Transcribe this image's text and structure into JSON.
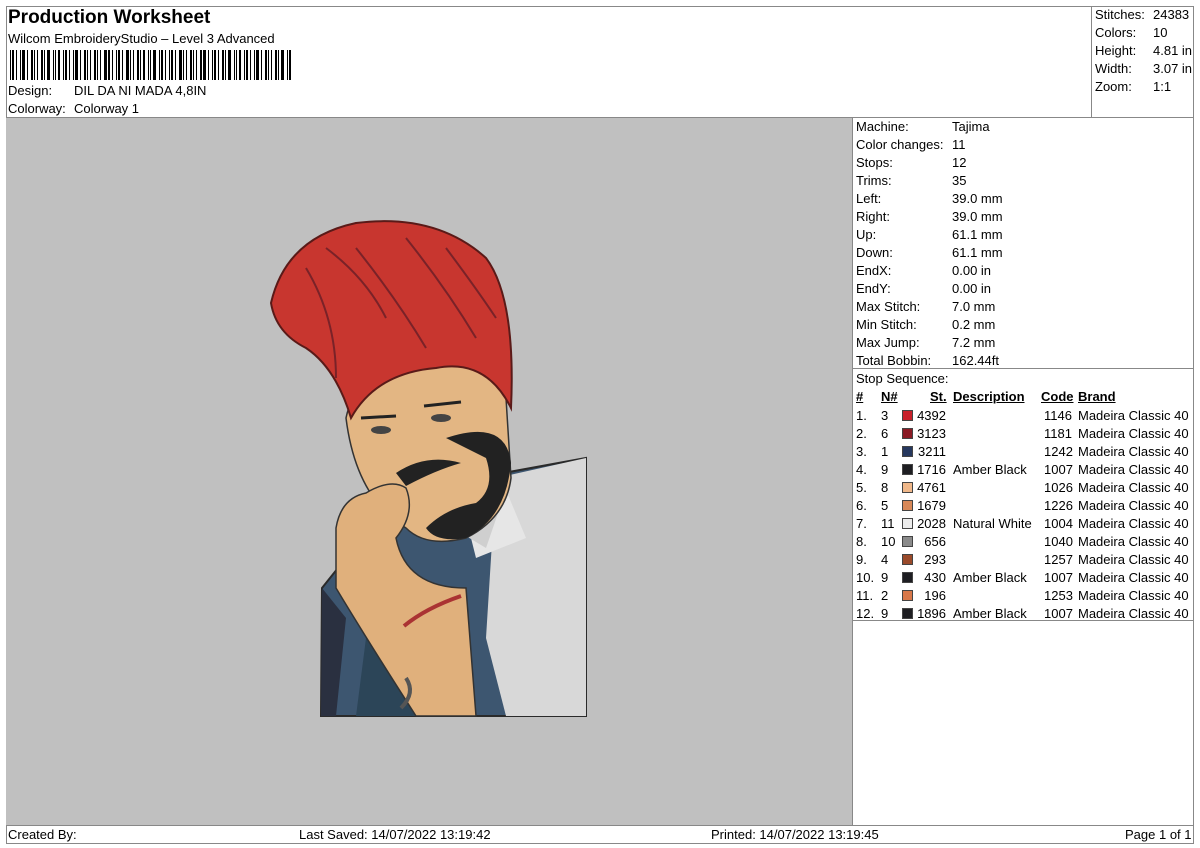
{
  "header": {
    "title": "Production Worksheet",
    "subtitle": "Wilcom EmbroideryStudio – Level 3 Advanced",
    "design_label": "Design:",
    "design_value": "DIL DA NI MADA 4,8IN",
    "colorway_label": "Colorway:",
    "colorway_value": "Colorway 1"
  },
  "summary": [
    {
      "label": "Stitches:",
      "value": "24383"
    },
    {
      "label": "Colors:",
      "value": "10"
    },
    {
      "label": "Height:",
      "value": "4.81 in"
    },
    {
      "label": "Width:",
      "value": "3.07 in"
    },
    {
      "label": "Zoom:",
      "value": "1:1"
    }
  ],
  "machine": [
    {
      "label": "Machine:",
      "value": "Tajima"
    },
    {
      "label": "Color changes:",
      "value": "11"
    },
    {
      "label": "Stops:",
      "value": "12"
    },
    {
      "label": "Trims:",
      "value": "35"
    },
    {
      "label": "Left:",
      "value": "39.0 mm"
    },
    {
      "label": "Right:",
      "value": "39.0 mm"
    },
    {
      "label": "Up:",
      "value": "61.1 mm"
    },
    {
      "label": "Down:",
      "value": "61.1 mm"
    },
    {
      "label": "EndX:",
      "value": "0.00 in"
    },
    {
      "label": "EndY:",
      "value": "0.00 in"
    },
    {
      "label": "Max Stitch:",
      "value": "7.0 mm"
    },
    {
      "label": "Min Stitch:",
      "value": "0.2 mm"
    },
    {
      "label": "Max Jump:",
      "value": "7.2 mm"
    },
    {
      "label": "Total Bobbin:",
      "value": "162.44ft"
    }
  ],
  "stop_sequence": {
    "title": "Stop Sequence:",
    "headers": {
      "num": "#",
      "n": "N#",
      "st": "St.",
      "desc": "Description",
      "code": "Code",
      "brand": "Brand"
    },
    "rows": [
      {
        "num": "1.",
        "n": "3",
        "color": "#c8202a",
        "st": "4392",
        "desc": "",
        "code": "1146",
        "brand": "Madeira Classic 40"
      },
      {
        "num": "2.",
        "n": "6",
        "color": "#8a1a24",
        "st": "3123",
        "desc": "",
        "code": "1181",
        "brand": "Madeira Classic 40"
      },
      {
        "num": "3.",
        "n": "1",
        "color": "#26385e",
        "st": "3211",
        "desc": "",
        "code": "1242",
        "brand": "Madeira Classic 40"
      },
      {
        "num": "4.",
        "n": "9",
        "color": "#1e1e22",
        "st": "1716",
        "desc": "Amber Black",
        "code": "1007",
        "brand": "Madeira Classic 40"
      },
      {
        "num": "5.",
        "n": "8",
        "color": "#f0b88a",
        "st": "4761",
        "desc": "",
        "code": "1026",
        "brand": "Madeira Classic 40"
      },
      {
        "num": "6.",
        "n": "5",
        "color": "#d88858",
        "st": "1679",
        "desc": "",
        "code": "1226",
        "brand": "Madeira Classic 40"
      },
      {
        "num": "7.",
        "n": "11",
        "color": "#ececec",
        "st": "2028",
        "desc": "Natural White",
        "code": "1004",
        "brand": "Madeira Classic 40"
      },
      {
        "num": "8.",
        "n": "10",
        "color": "#8a8a8a",
        "st": "656",
        "desc": "",
        "code": "1040",
        "brand": "Madeira Classic 40"
      },
      {
        "num": "9.",
        "n": "4",
        "color": "#9a4a2a",
        "st": "293",
        "desc": "",
        "code": "1257",
        "brand": "Madeira Classic 40"
      },
      {
        "num": "10.",
        "n": "9",
        "color": "#1e1e22",
        "st": "430",
        "desc": "Amber Black",
        "code": "1007",
        "brand": "Madeira Classic 40"
      },
      {
        "num": "11.",
        "n": "2",
        "color": "#d8784a",
        "st": "196",
        "desc": "",
        "code": "1253",
        "brand": "Madeira Classic 40"
      },
      {
        "num": "12.",
        "n": "9",
        "color": "#1e1e22",
        "st": "1896",
        "desc": "Amber Black",
        "code": "1007",
        "brand": "Madeira Classic 40"
      }
    ]
  },
  "footer": {
    "created_by": "Created By:",
    "last_saved": "Last Saved: 14/07/2022 13:19:42",
    "printed": "Printed: 14/07/2022 13:19:45",
    "page": "Page 1 of 1"
  }
}
